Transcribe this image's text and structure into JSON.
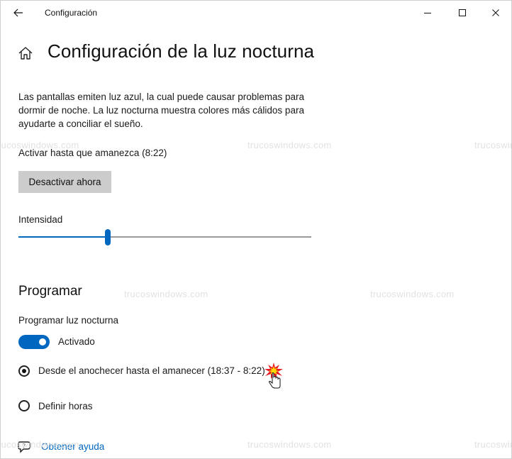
{
  "titlebar": {
    "title": "Configuración",
    "back_icon": "arrow-left-icon",
    "minimize_icon": "minimize-icon",
    "maximize_icon": "maximize-icon",
    "close_icon": "close-icon"
  },
  "page": {
    "home_icon": "home-icon",
    "title": "Configuración de la luz nocturna",
    "description": "Las pantallas emiten luz azul, la cual puede causar problemas para dormir de noche. La luz nocturna muestra colores más cálidos para ayudarte a conciliar el sueño.",
    "status": "Activar hasta que amanezca (8:22)",
    "deactivate_button": "Desactivar ahora"
  },
  "intensity": {
    "label": "Intensidad",
    "value_fraction": 0.305
  },
  "schedule": {
    "heading": "Programar",
    "label": "Programar luz nocturna",
    "toggle_on": true,
    "toggle_label": "Activado",
    "options": [
      {
        "label": "Desde el anochecer hasta el amanecer (18:37 - 8:22)",
        "selected": true
      },
      {
        "label": "Definir horas",
        "selected": false
      }
    ]
  },
  "help": {
    "icon": "help-chat-icon",
    "link": "Obtener ayuda"
  },
  "watermark": "trucoswindows.com",
  "colors": {
    "accent": "#0067c0",
    "button_bg": "#cccccc",
    "watermark": "#e2e2e2"
  }
}
